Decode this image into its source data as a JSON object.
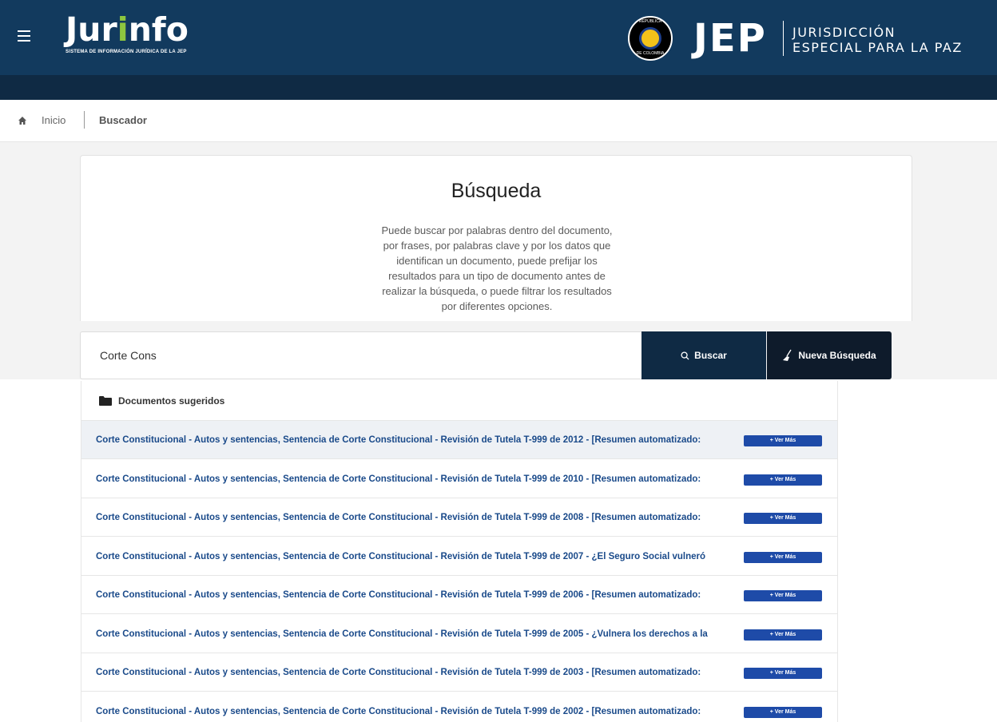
{
  "header": {
    "logo_prefix": "Jur",
    "logo_i": "i",
    "logo_suffix": "nfo",
    "logo_subtitle": "SISTEMA DE INFORMACIÓN JURÍDICA DE LA JEP",
    "seal_top": "REPÚBLICA",
    "seal_bottom": "DE COLOMBIA",
    "jep_mark": "JEP",
    "jep_line1": "JURISDICCIÓN",
    "jep_line2": "ESPECIAL PARA LA PAZ"
  },
  "breadcrumb": {
    "home": "Inicio",
    "current": "Buscador"
  },
  "card": {
    "title": "Búsqueda",
    "description": "Puede buscar por palabras dentro del documento, por frases, por palabras clave y por los datos que identifican un documento, puede prefijar los resultados para un tipo de documento antes de realizar la búsqueda, o puede filtrar los resultados por diferentes opciones."
  },
  "search": {
    "value": "Corte Cons",
    "buscar_label": "Buscar",
    "nueva_label": "Nueva Búsqueda"
  },
  "suggestions": {
    "header": "Documentos sugeridos",
    "button_label": "+ Ver Más",
    "items": [
      {
        "text": "Corte Constitucional - Autos y sentencias, Sentencia de Corte Constitucional - Revisión de Tutela T-999 de 2012 - [Resumen automatizado:"
      },
      {
        "text": "Corte Constitucional - Autos y sentencias, Sentencia de Corte Constitucional - Revisión de Tutela T-999 de 2010 - [Resumen automatizado:"
      },
      {
        "text": "Corte Constitucional - Autos y sentencias, Sentencia de Corte Constitucional - Revisión de Tutela T-999 de 2008 - [Resumen automatizado:"
      },
      {
        "text": "Corte Constitucional - Autos y sentencias, Sentencia de Corte Constitucional - Revisión de Tutela T-999 de 2007 - ¿El Seguro Social vulneró"
      },
      {
        "text": "Corte Constitucional - Autos y sentencias, Sentencia de Corte Constitucional - Revisión de Tutela T-999 de 2006 - [Resumen automatizado:"
      },
      {
        "text": "Corte Constitucional - Autos y sentencias, Sentencia de Corte Constitucional - Revisión de Tutela T-999 de 2005 - ¿Vulnera los derechos a la"
      },
      {
        "text": "Corte Constitucional - Autos y sentencias, Sentencia de Corte Constitucional - Revisión de Tutela T-999 de 2003 - [Resumen automatizado:"
      },
      {
        "text": "Corte Constitucional - Autos y sentencias, Sentencia de Corte Constitucional - Revisión de Tutela T-999 de 2002 - [Resumen automatizado:"
      }
    ]
  }
}
